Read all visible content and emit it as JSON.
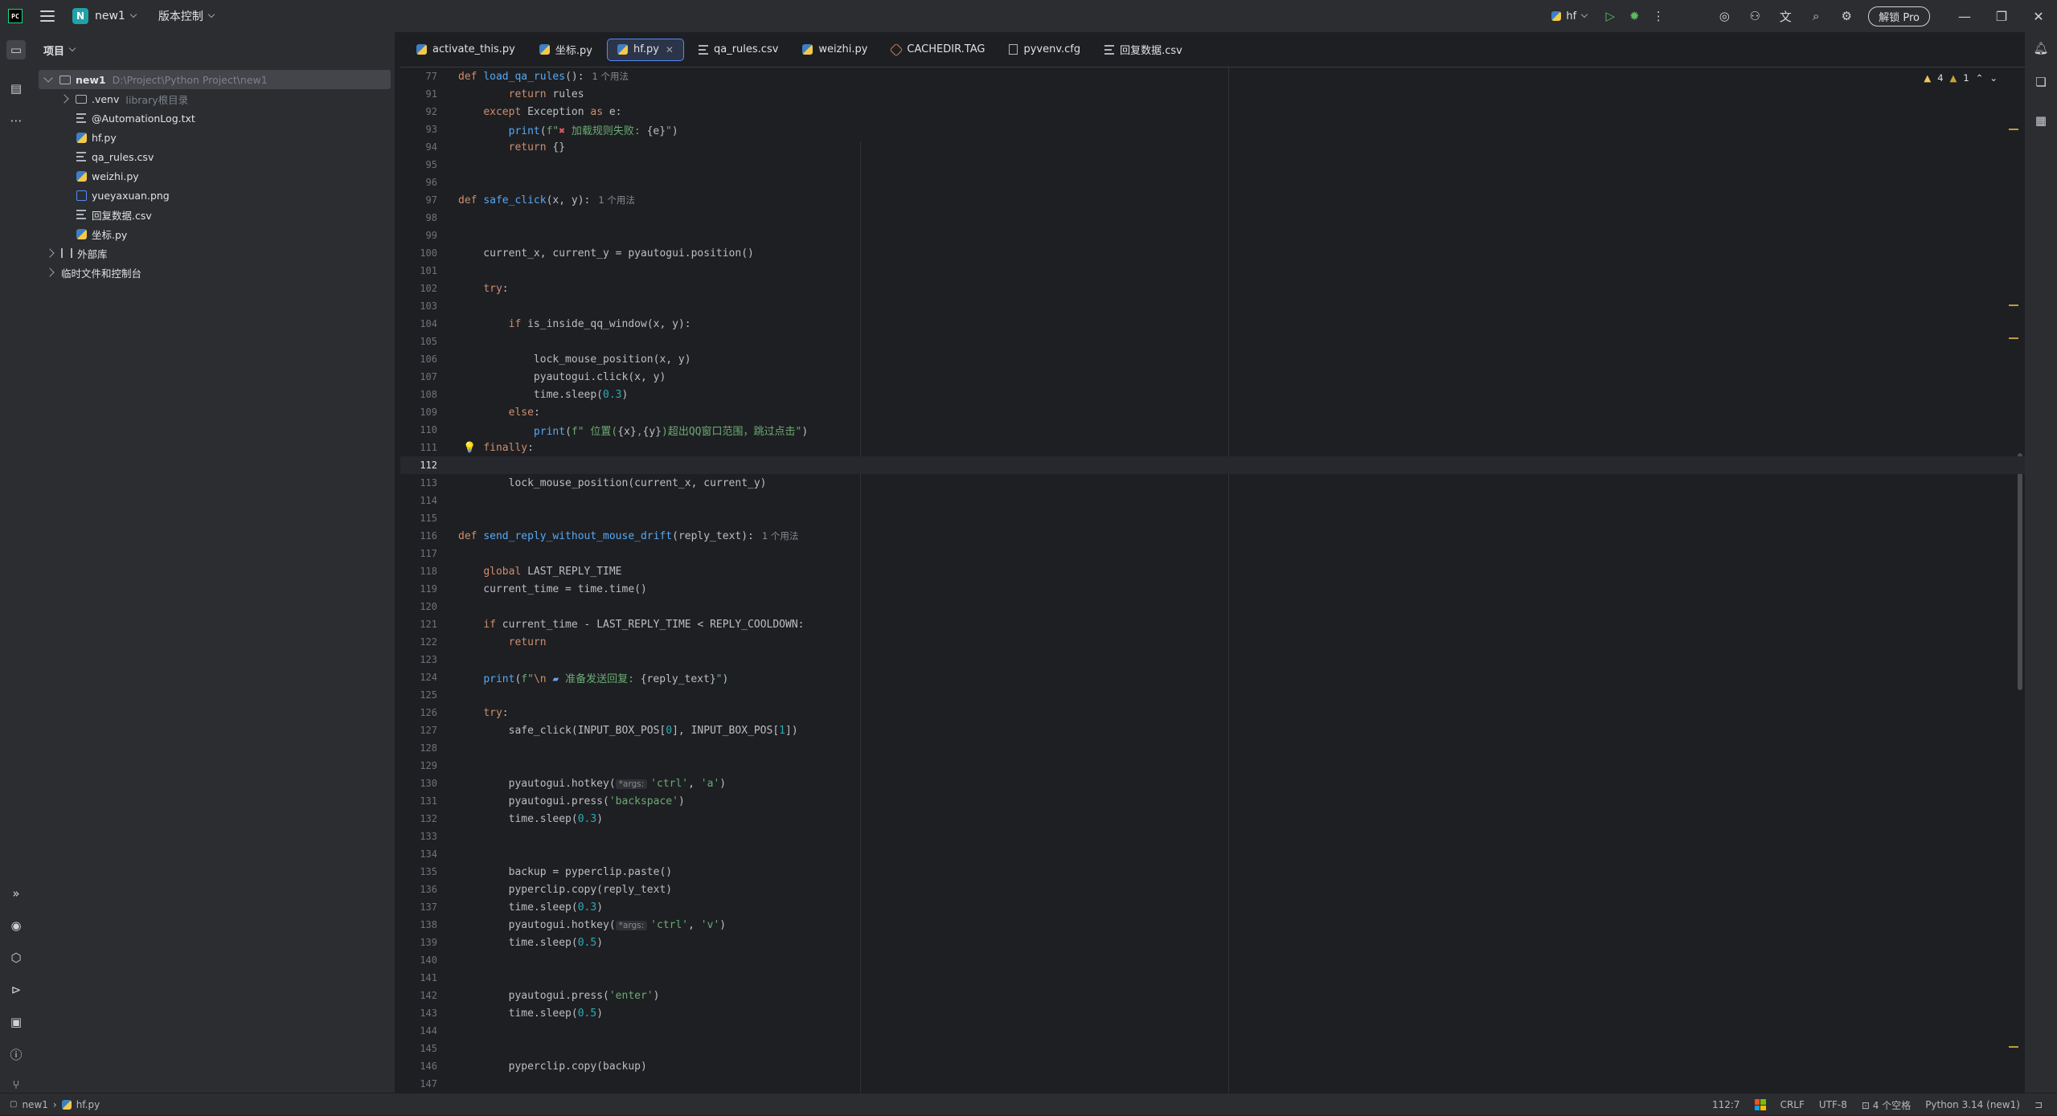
{
  "titlebar": {
    "project_badge": "N",
    "project_name": "new1",
    "vcs_label": "版本控制",
    "run_config": "hf",
    "pro_button": "解锁 Pro"
  },
  "project_panel": {
    "title": "项目",
    "root": {
      "name": "new1",
      "path": "D:\\Project\\Python Project\\new1"
    },
    "venv": {
      "name": ".venv",
      "note": "library根目录"
    },
    "files": [
      "@AutomationLog.txt",
      "hf.py",
      "qa_rules.csv",
      "weizhi.py",
      "yueyaxuan.png",
      "回复数据.csv",
      "坐标.py"
    ],
    "external_libs": "外部库",
    "scratches": "临时文件和控制台"
  },
  "tabs": [
    {
      "label": "activate_this.py",
      "icon": "python-icon"
    },
    {
      "label": "坐标.py",
      "icon": "python-icon"
    },
    {
      "label": "hf.py",
      "icon": "python-icon",
      "active": true
    },
    {
      "label": "qa_rules.csv",
      "icon": "text-icon"
    },
    {
      "label": "weizhi.py",
      "icon": "python-icon"
    },
    {
      "label": "CACHEDIR.TAG",
      "icon": "tag-icon"
    },
    {
      "label": "pyvenv.cfg",
      "icon": "config-icon"
    },
    {
      "label": "回复数据.csv",
      "icon": "text-icon"
    }
  ],
  "inspections": {
    "warnings": "4",
    "weak_warnings": "1"
  },
  "editor": {
    "current_line": 112,
    "usage_hint": "1 个用法",
    "args_hint": "*args:",
    "lines": [
      "77",
      "91",
      "92",
      "93",
      "94",
      "95",
      "96",
      "97",
      "98",
      "99",
      "100",
      "101",
      "102",
      "103",
      "104",
      "105",
      "106",
      "107",
      "108",
      "109",
      "110",
      "111",
      "112",
      "113",
      "114",
      "115",
      "116",
      "117",
      "118",
      "119",
      "120",
      "121",
      "122",
      "123",
      "124",
      "125",
      "126",
      "127",
      "128",
      "129",
      "130",
      "131",
      "132",
      "133",
      "134",
      "135",
      "136",
      "137",
      "138",
      "139",
      "140",
      "141",
      "142",
      "143",
      "144",
      "145",
      "146",
      "147"
    ]
  },
  "statusbar": {
    "breadcrumb_project": "new1",
    "breadcrumb_file": "hf.py",
    "caret": "112:7",
    "line_sep": "CRLF",
    "encoding": "UTF-8",
    "indent": "4 个空格",
    "interpreter": "Python 3.14 (new1)"
  }
}
